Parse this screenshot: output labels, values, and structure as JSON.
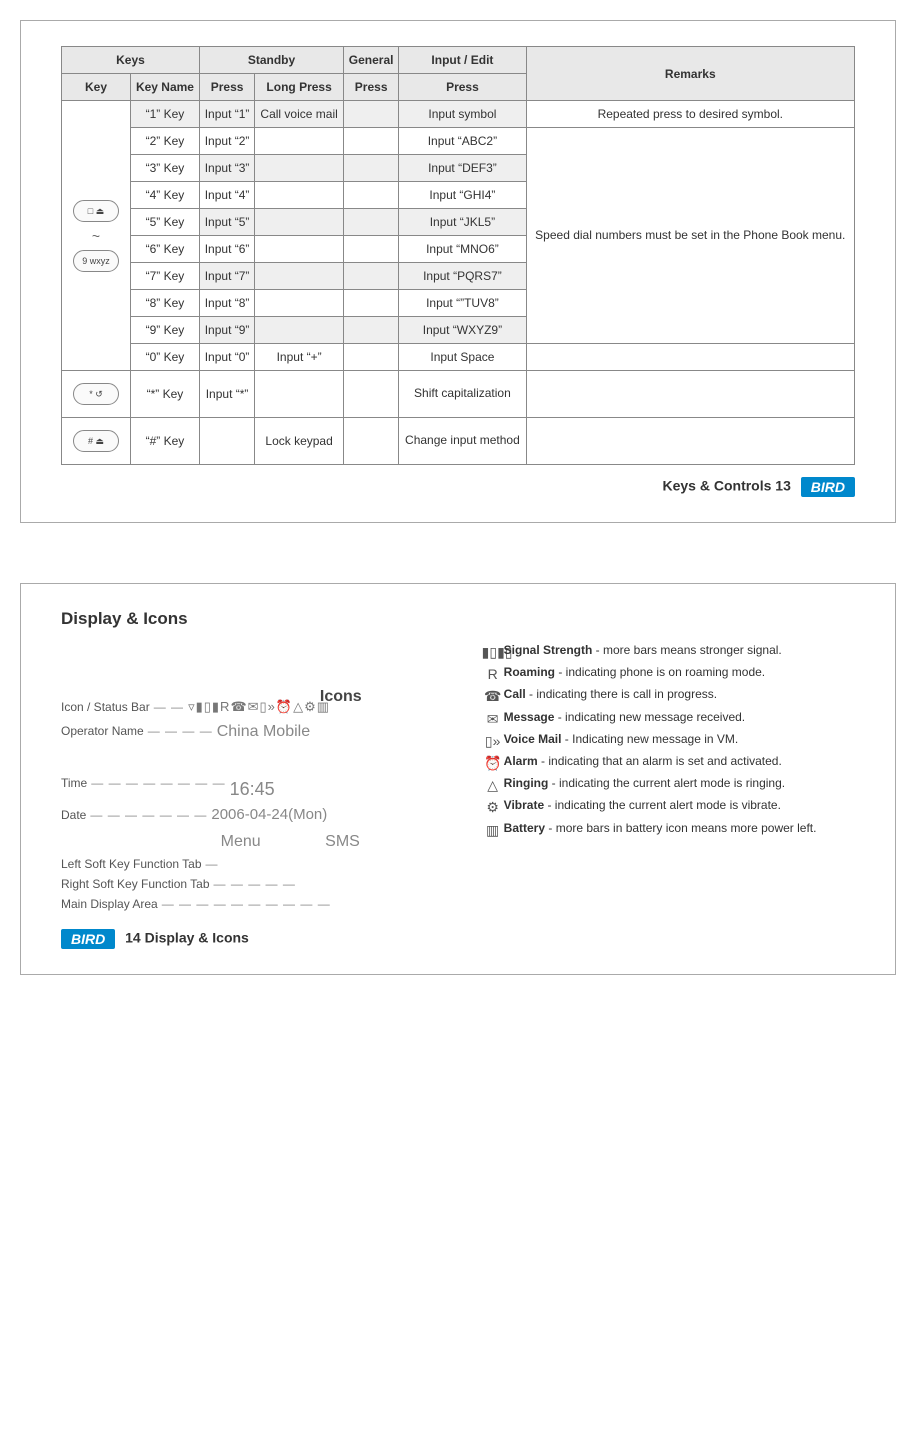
{
  "page1": {
    "headers": {
      "keys": "Keys",
      "standby": "Standby",
      "general": "General",
      "input_edit": "Input / Edit",
      "remarks": "Remarks",
      "key": "Key",
      "key_name": "Key Name",
      "press1": "Press",
      "long_press": "Long Press",
      "press2": "Press",
      "press3": "Press"
    },
    "key_icon_top": "□ ⏏",
    "key_icon_mid": "~",
    "key_icon_bot": "9 wxyz",
    "key_icon_star": "* ↺",
    "key_icon_hash": "# ⏏",
    "rows": [
      {
        "shaded": true,
        "name": "“1” Key",
        "press": "Input “1”",
        "long": "Call voice mail",
        "gen": "",
        "inp": "Input symbol",
        "rem": "Repeated press to desired symbol."
      },
      {
        "shaded": false,
        "name": "“2” Key",
        "press": "Input “2”",
        "long": "",
        "gen": "",
        "inp": "Input “ABC2”",
        "rem": ""
      },
      {
        "shaded": true,
        "name": "“3” Key",
        "press": "Input “3”",
        "long": "",
        "gen": "",
        "inp": "Input “DEF3”",
        "rem": ""
      },
      {
        "shaded": false,
        "name": "“4” Key",
        "press": "Input “4”",
        "long": "",
        "gen": "",
        "inp": "Input “GHI4”",
        "rem": ""
      },
      {
        "shaded": true,
        "name": "“5” Key",
        "press": "Input “5”",
        "long": "",
        "gen": "",
        "inp": "Input “JKL5”",
        "rem": ""
      },
      {
        "shaded": false,
        "name": "“6” Key",
        "press": "Input “6”",
        "long": "",
        "gen": "",
        "inp": "Input “MNO6”",
        "rem": ""
      },
      {
        "shaded": true,
        "name": "“7” Key",
        "press": "Input “7”",
        "long": "",
        "gen": "",
        "inp": "Input “PQRS7”",
        "rem": ""
      },
      {
        "shaded": false,
        "name": "“8” Key",
        "press": "Input “8”",
        "long": "",
        "gen": "",
        "inp": "Input “”TUV8”",
        "rem": ""
      },
      {
        "shaded": true,
        "name": "“9” Key",
        "press": "Input “9”",
        "long": "",
        "gen": "",
        "inp": "Input “WXYZ9”",
        "rem": ""
      },
      {
        "shaded": false,
        "name": "“0” Key",
        "press": "Input “0”",
        "long": "Input “+”",
        "gen": "",
        "inp": "Input Space",
        "rem": ""
      }
    ],
    "remarks_speed_dial": "Speed dial numbers must be set in the Phone Book menu.",
    "star": {
      "name": "“*” Key",
      "press": "Input “*”",
      "long": "",
      "gen": "",
      "inp": "Shift capitalization",
      "rem": ""
    },
    "hash": {
      "name": "“#” Key",
      "press": "",
      "long": "Lock keypad",
      "gen": "",
      "inp": "Change input method",
      "rem": ""
    },
    "footer": "Keys & Controls 13",
    "brand": "BIRD"
  },
  "page2": {
    "title": "Display & Icons",
    "icons_label": "Icons",
    "diagram_labels": {
      "status_bar": "Icon / Status Bar",
      "operator": "Operator Name",
      "time": "Time",
      "date": "Date",
      "left_soft": "Left Soft Key Function Tab",
      "right_soft": "Right Soft Key Function Tab",
      "main_area": "Main Display Area"
    },
    "screen": {
      "iconbar": "▿▮▯▮R☎✉▯»⏰△⚙▥",
      "operator": "China Mobile",
      "time": "16:45",
      "date": "2006-04-24(Mon)",
      "menu": "Menu",
      "sms": "SMS"
    },
    "icons": [
      {
        "glyph": "▮▯▮▯",
        "name": "Signal Strength",
        "desc": " - more bars means stronger signal."
      },
      {
        "glyph": "R",
        "name": "Roaming",
        "desc": " - indicating phone is on roaming mode."
      },
      {
        "glyph": "☎",
        "name": "Call",
        "desc": " - indicating there is call in progress."
      },
      {
        "glyph": "✉",
        "name": "Message",
        "desc": " - indicating new message received."
      },
      {
        "glyph": "▯»",
        "name": "Voice Mail",
        "desc": " -  Indicating new message in VM."
      },
      {
        "glyph": "⏰",
        "name": "Alarm",
        "desc": " - indicating that an alarm is set and activated."
      },
      {
        "glyph": "△",
        "name": "Ringing",
        "desc": " - indicating the current alert mode is ringing."
      },
      {
        "glyph": "⚙",
        "name": "Vibrate",
        "desc": " - indicating the current alert mode is vibrate."
      },
      {
        "glyph": "▥",
        "name": "Battery",
        "desc": " - more bars in battery icon means more power left."
      }
    ],
    "footer": "14 Display & Icons",
    "brand": "BIRD"
  }
}
